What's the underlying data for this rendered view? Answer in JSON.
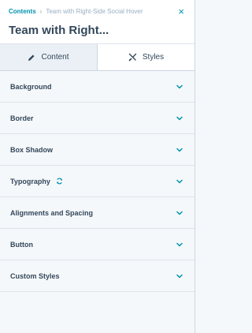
{
  "header": {
    "breadcrumb_root": "Contents",
    "breadcrumb_separator": "›",
    "breadcrumb_current": "Team with Right-Side Social Hover",
    "close_glyph": "×",
    "title": "Team with Right..."
  },
  "tabs": [
    {
      "label": "Content",
      "icon": "pencil-icon",
      "active": false
    },
    {
      "label": "Styles",
      "icon": "brush-icon",
      "active": true
    }
  ],
  "sections": [
    {
      "label": "Background"
    },
    {
      "label": "Border"
    },
    {
      "label": "Box Shadow"
    },
    {
      "label": "Typography",
      "has_sync_icon": true
    },
    {
      "label": "Alignments and Spacing"
    },
    {
      "label": "Button"
    },
    {
      "label": "Custom Styles"
    }
  ],
  "colors": {
    "accent": "#0091ae",
    "text": "#33475b",
    "panel_bg": "#f5f8fa",
    "tab_inactive_bg": "#eaf0f6"
  }
}
